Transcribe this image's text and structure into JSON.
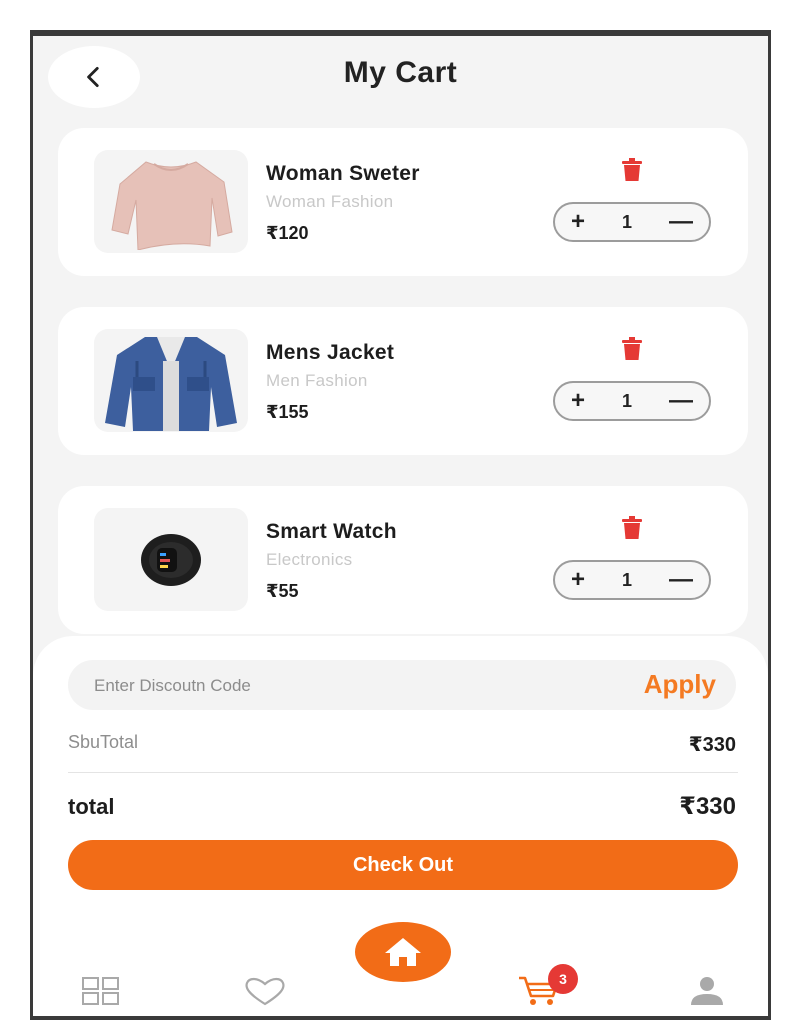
{
  "header": {
    "title": "My Cart",
    "back_icon": "chevron-left-icon"
  },
  "cart": {
    "items": [
      {
        "name": "Woman Sweter",
        "category": "Woman Fashion",
        "price": "₹120",
        "quantity": "1",
        "image": "sweater-image"
      },
      {
        "name": "Mens Jacket",
        "category": "Men Fashion",
        "price": "₹155",
        "quantity": "1",
        "image": "jacket-image"
      },
      {
        "name": "Smart Watch",
        "category": "Electronics",
        "price": "₹55",
        "quantity": "1",
        "image": "watch-image"
      }
    ],
    "increment_label": "+",
    "decrement_label": "—"
  },
  "summary": {
    "discount_placeholder": "Enter Discoutn Code",
    "apply_label": "Apply",
    "subtotal_label": "SbuTotal",
    "subtotal_value": "₹330",
    "total_label": "total",
    "total_value": "₹330",
    "checkout_label": "Check Out"
  },
  "bottom_nav": {
    "items": [
      "grid-icon",
      "heart-icon",
      "home-icon",
      "cart-icon",
      "user-icon"
    ],
    "cart_badge": "3",
    "active": "cart-icon"
  },
  "colors": {
    "accent": "#f26c17",
    "apply": "#f47a22",
    "delete": "#e53935",
    "background": "#f4f4f4",
    "card": "#ffffff"
  }
}
